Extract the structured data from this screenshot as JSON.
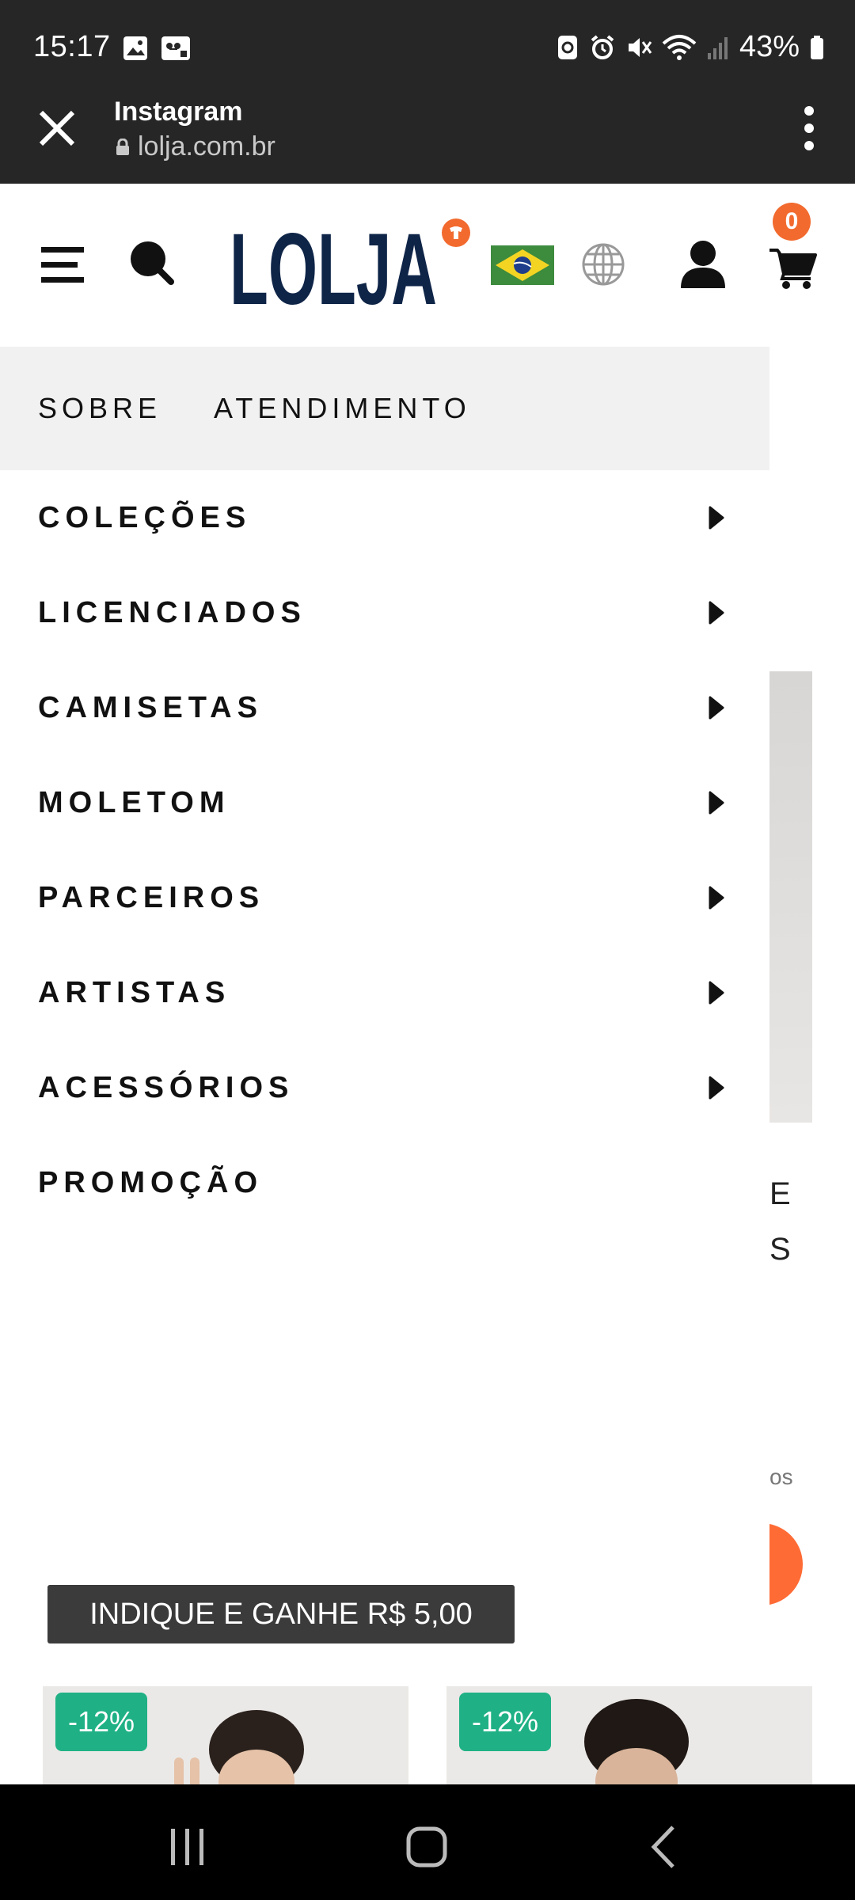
{
  "status_bar": {
    "time": "15:17",
    "battery": "43%"
  },
  "browser": {
    "title": "Instagram",
    "url": "lolja.com.br"
  },
  "header": {
    "logo_text": "LOLJA",
    "cart_count": "0"
  },
  "drawer": {
    "top_links": [
      "SOBRE",
      "ATENDIMENTO"
    ],
    "menu": [
      {
        "label": "COLEÇÕES",
        "has_arrow": true
      },
      {
        "label": "LICENCIADOS",
        "has_arrow": true
      },
      {
        "label": "CAMISETAS",
        "has_arrow": true
      },
      {
        "label": "MOLETOM",
        "has_arrow": true
      },
      {
        "label": "PARCEIROS",
        "has_arrow": true
      },
      {
        "label": "ARTISTAS",
        "has_arrow": true
      },
      {
        "label": "ACESSÓRIOS",
        "has_arrow": true
      },
      {
        "label": "PROMOÇÃO",
        "has_arrow": false
      }
    ]
  },
  "referral_banner": "INDIQUE E GANHE R$ 5,00",
  "background_fragments": {
    "line1": "E",
    "line2": "S",
    "small": "os"
  },
  "products": [
    {
      "discount": "-12%"
    },
    {
      "discount": "-12%"
    }
  ],
  "colors": {
    "accent": "#f26a2e",
    "brand_navy": "#0f2548",
    "discount_green": "#1fb185"
  }
}
